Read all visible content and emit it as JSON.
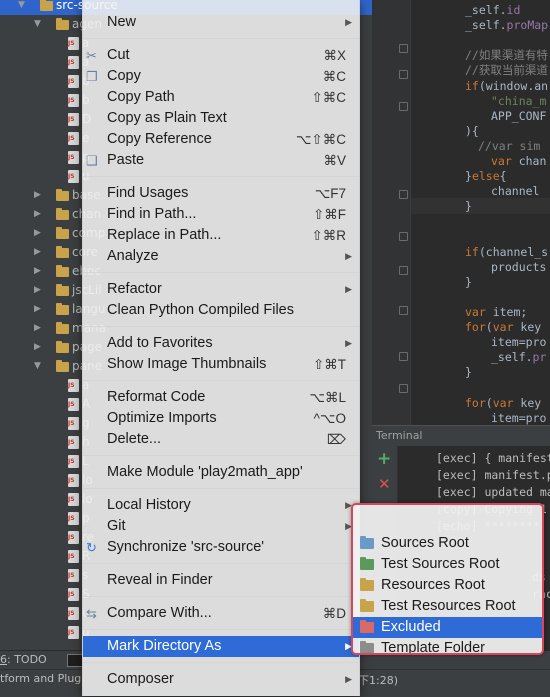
{
  "tree": {
    "rows": [
      {
        "label": "src-source",
        "indent": 0,
        "arrow": "down",
        "type": "folder",
        "selected": true
      },
      {
        "label": "agen",
        "indent": 1,
        "arrow": "down",
        "type": "folder"
      },
      {
        "label": "a",
        "indent": 2,
        "type": "file"
      },
      {
        "label": "a",
        "indent": 2,
        "type": "file"
      },
      {
        "label": "b",
        "indent": 2,
        "type": "file"
      },
      {
        "label": "b",
        "indent": 2,
        "type": "file"
      },
      {
        "label": "D",
        "indent": 2,
        "type": "file"
      },
      {
        "label": "e",
        "indent": 2,
        "type": "file"
      },
      {
        "label": "p",
        "indent": 2,
        "type": "file"
      },
      {
        "label": "u",
        "indent": 2,
        "type": "file"
      },
      {
        "label": "base",
        "indent": 1,
        "arrow": "right",
        "type": "folder"
      },
      {
        "label": "chan",
        "indent": 1,
        "arrow": "right",
        "type": "folder"
      },
      {
        "label": "comp",
        "indent": 1,
        "arrow": "right",
        "type": "folder"
      },
      {
        "label": "core",
        "indent": 1,
        "arrow": "right",
        "type": "folder"
      },
      {
        "label": "eboc",
        "indent": 1,
        "arrow": "right",
        "type": "folder"
      },
      {
        "label": "jscLil",
        "indent": 1,
        "arrow": "right",
        "type": "folder"
      },
      {
        "label": "langu",
        "indent": 1,
        "arrow": "right",
        "type": "folder"
      },
      {
        "label": "mana",
        "indent": 1,
        "arrow": "right",
        "type": "folder"
      },
      {
        "label": "page",
        "indent": 1,
        "arrow": "right",
        "type": "folder"
      },
      {
        "label": "pane",
        "indent": 1,
        "arrow": "down",
        "type": "folder"
      },
      {
        "label": "a",
        "indent": 2,
        "type": "file"
      },
      {
        "label": "A",
        "indent": 2,
        "type": "file"
      },
      {
        "label": "g",
        "indent": 2,
        "type": "file"
      },
      {
        "label": "h",
        "indent": 2,
        "type": "file"
      },
      {
        "label": "L",
        "indent": 2,
        "type": "file"
      },
      {
        "label": "lo",
        "indent": 2,
        "type": "file"
      },
      {
        "label": "lo",
        "indent": 2,
        "type": "file"
      },
      {
        "label": "p",
        "indent": 2,
        "type": "file"
      },
      {
        "label": "re",
        "indent": 2,
        "type": "file"
      },
      {
        "label": "R",
        "indent": 2,
        "type": "file"
      },
      {
        "label": "s",
        "indent": 2,
        "type": "file"
      },
      {
        "label": "S",
        "indent": 2,
        "type": "file"
      },
      {
        "label": "u",
        "indent": 2,
        "type": "file"
      },
      {
        "label": "u",
        "indent": 2,
        "type": "file"
      }
    ]
  },
  "editor": {
    "lines": [
      {
        "row": 0,
        "parts": [
          [
            "_self.",
            "pl"
          ],
          [
            "id",
            "pur"
          ]
        ]
      },
      {
        "row": 1,
        "parts": [
          [
            "_self.",
            "pl"
          ],
          [
            "proMap",
            "pur"
          ]
        ]
      },
      {
        "row": 3,
        "parts": [
          [
            "//如果渠道有特",
            "cm"
          ]
        ]
      },
      {
        "row": 4,
        "parts": [
          [
            "//获取当前渠道",
            "cm"
          ]
        ]
      },
      {
        "row": 5,
        "parts": [
          [
            "if",
            "kw"
          ],
          [
            "(window.an",
            "pl"
          ]
        ]
      },
      {
        "row": 6,
        "indent": 2,
        "parts": [
          [
            "\"china_m",
            "str"
          ]
        ]
      },
      {
        "row": 7,
        "indent": 2,
        "parts": [
          [
            "APP_CONF",
            "pl"
          ]
        ]
      },
      {
        "row": 8,
        "parts": [
          [
            "){",
            "pl"
          ]
        ]
      },
      {
        "row": 9,
        "indent": 1,
        "parts": [
          [
            "//var sim",
            "cm"
          ]
        ]
      },
      {
        "row": 10,
        "indent": 2,
        "parts": [
          [
            "var ",
            "kw"
          ],
          [
            "chan",
            "pl"
          ]
        ]
      },
      {
        "row": 11,
        "parts": [
          [
            "}",
            "pl"
          ],
          [
            "else",
            "kw"
          ],
          [
            "{",
            "pl"
          ]
        ]
      },
      {
        "row": 12,
        "indent": 2,
        "parts": [
          [
            "channel",
            "pl"
          ]
        ]
      },
      {
        "row": 13,
        "parts": [
          [
            "}",
            "pl"
          ]
        ]
      },
      {
        "row": 16,
        "parts": [
          [
            "if",
            "kw"
          ],
          [
            "(channel_s",
            "pl"
          ]
        ]
      },
      {
        "row": 17,
        "indent": 2,
        "parts": [
          [
            "products",
            "pl"
          ]
        ]
      },
      {
        "row": 18,
        "parts": [
          [
            "}",
            "pl"
          ]
        ]
      },
      {
        "row": 20,
        "parts": [
          [
            "var ",
            "kw"
          ],
          [
            "item;",
            "pl"
          ]
        ]
      },
      {
        "row": 21,
        "parts": [
          [
            "for",
            "kw"
          ],
          [
            "(",
            "pl"
          ],
          [
            "var ",
            "kw"
          ],
          [
            "key",
            "pl"
          ]
        ]
      },
      {
        "row": 22,
        "indent": 2,
        "parts": [
          [
            "item=pro",
            "pl"
          ]
        ]
      },
      {
        "row": 23,
        "indent": 2,
        "parts": [
          [
            "_self.",
            "pl"
          ],
          [
            "pr",
            "pur"
          ]
        ]
      },
      {
        "row": 24,
        "parts": [
          [
            "}",
            "pl"
          ]
        ]
      },
      {
        "row": 26,
        "parts": [
          [
            "for",
            "kw"
          ],
          [
            "(",
            "pl"
          ],
          [
            "var ",
            "kw"
          ],
          [
            "key",
            "pl"
          ]
        ]
      },
      {
        "row": 27,
        "indent": 2,
        "parts": [
          [
            "item=pro",
            "pl"
          ]
        ]
      },
      {
        "row": 28,
        "indent": 2,
        "parts": [
          [
            "_self.",
            "pl"
          ],
          [
            "pr",
            "pur"
          ]
        ]
      }
    ]
  },
  "terminal": {
    "title": "Terminal",
    "lines": [
      "[exec] { manifest",
      "[exec] manifest.p",
      "[exec] updated ma",
      "[copy] Copying 1",
      "[echo] ********",
      "",
      "",
      "ds",
      "rac"
    ]
  },
  "toolbar": {
    "todo_num": "6",
    "todo_label": ": TODO"
  },
  "statusbar": {
    "left_text": "tform and Plugi",
    "right_text": "下1:28)"
  },
  "menu": {
    "groups": [
      [
        {
          "label": "New",
          "submenu": true
        }
      ],
      [
        {
          "label": "Cut",
          "shortcut": "⌘X",
          "icon": "scissors-icon"
        },
        {
          "label": "Copy",
          "shortcut": "⌘C",
          "icon": "copy-icon"
        },
        {
          "label": "Copy Path",
          "shortcut": "⇧⌘C"
        },
        {
          "label": "Copy as Plain Text"
        },
        {
          "label": "Copy Reference",
          "shortcut": "⌥⇧⌘C"
        },
        {
          "label": "Paste",
          "shortcut": "⌘V",
          "icon": "paste-icon"
        }
      ],
      [
        {
          "label": "Find Usages",
          "shortcut": "⌥F7"
        },
        {
          "label": "Find in Path...",
          "shortcut": "⇧⌘F"
        },
        {
          "label": "Replace in Path...",
          "shortcut": "⇧⌘R"
        },
        {
          "label": "Analyze",
          "submenu": true
        }
      ],
      [
        {
          "label": "Refactor",
          "submenu": true
        },
        {
          "label": "Clean Python Compiled Files"
        }
      ],
      [
        {
          "label": "Add to Favorites",
          "submenu": true
        },
        {
          "label": "Show Image Thumbnails",
          "shortcut": "⇧⌘T"
        }
      ],
      [
        {
          "label": "Reformat Code",
          "shortcut": "⌥⌘L"
        },
        {
          "label": "Optimize Imports",
          "shortcut": "^⌥O"
        },
        {
          "label": "Delete...",
          "shortcut": "⌦"
        }
      ],
      [
        {
          "label": "Make Module 'play2math_app'"
        }
      ],
      [
        {
          "label": "Local History",
          "submenu": true
        },
        {
          "label": "Git",
          "submenu": true
        },
        {
          "label": "Synchronize 'src-source'",
          "icon": "sync-icon"
        }
      ],
      [
        {
          "label": "Reveal in Finder"
        }
      ],
      [
        {
          "label": "Compare With...",
          "shortcut": "⌘D",
          "icon": "compare-icon"
        }
      ],
      [
        {
          "label": "Mark Directory As",
          "submenu": true,
          "highlighted": true
        }
      ],
      [
        {
          "label": "Composer",
          "submenu": true
        }
      ]
    ]
  },
  "submenu": {
    "items": [
      {
        "label": "Sources Root",
        "color": "#6c9ac8"
      },
      {
        "label": "Test Sources Root",
        "color": "#5c9a5c"
      },
      {
        "label": "Resources Root",
        "color": "#c9a34a"
      },
      {
        "label": "Test Resources Root",
        "color": "#c9a34a"
      },
      {
        "label": "Excluded",
        "color": "#d96a6a",
        "highlighted": true
      },
      {
        "label": "Template Folder",
        "color": "#8c8c8c"
      }
    ]
  }
}
